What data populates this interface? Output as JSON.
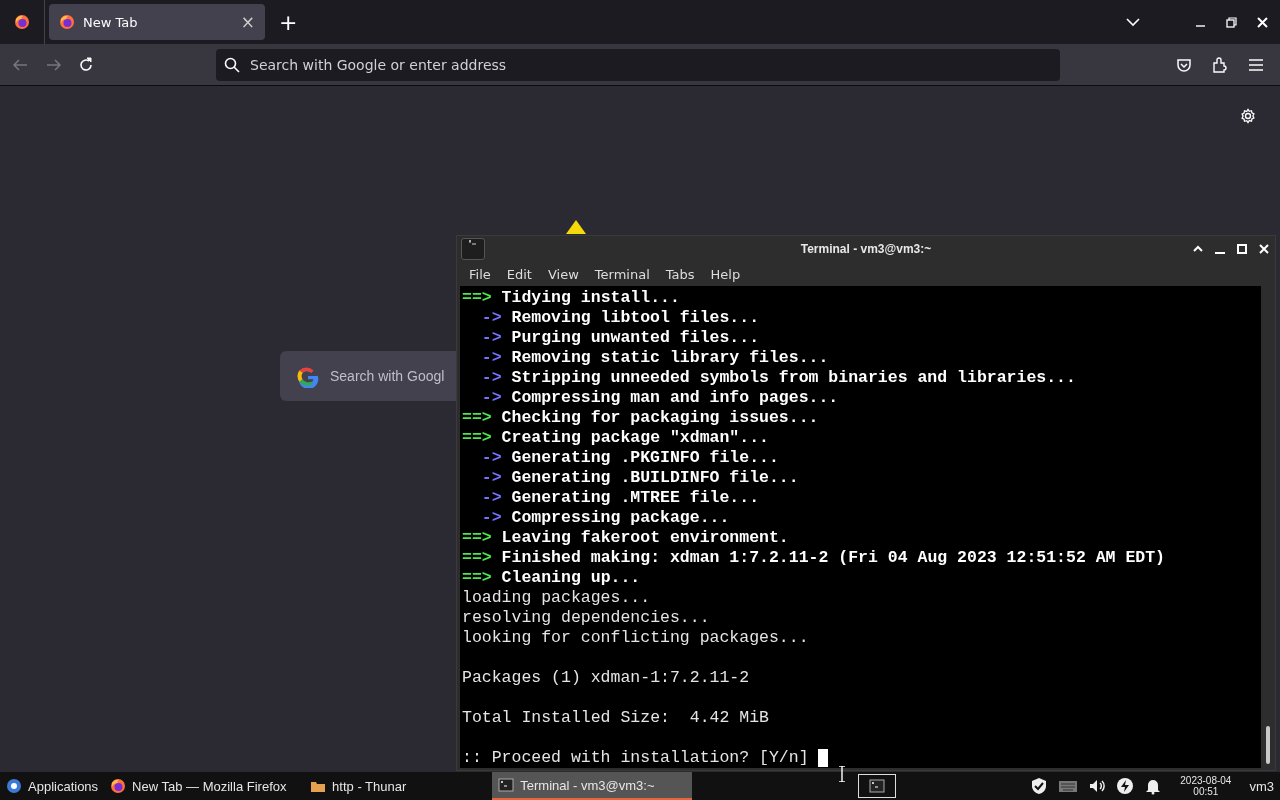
{
  "browser": {
    "tabs": [
      {
        "label": "New Tab",
        "selected": true,
        "close": "×"
      }
    ],
    "new_tab": "+",
    "address": {
      "placeholder": "Search with Google or enter address"
    },
    "content": {
      "search": {
        "placeholder": "Search with Googl"
      }
    }
  },
  "terminal": {
    "title": "Terminal - vm3@vm3:~",
    "menu": [
      "File",
      "Edit",
      "View",
      "Terminal",
      "Tabs",
      "Help"
    ],
    "lines": [
      {
        "kind": "main",
        "arrow": "==>",
        "text": "Tidying install..."
      },
      {
        "kind": "sub",
        "arrow": "->",
        "text": "Removing libtool files..."
      },
      {
        "kind": "sub",
        "arrow": "->",
        "text": "Purging unwanted files..."
      },
      {
        "kind": "sub",
        "arrow": "->",
        "text": "Removing static library files..."
      },
      {
        "kind": "sub",
        "arrow": "->",
        "text": "Stripping unneeded symbols from binaries and libraries..."
      },
      {
        "kind": "sub",
        "arrow": "->",
        "text": "Compressing man and info pages..."
      },
      {
        "kind": "main",
        "arrow": "==>",
        "text": "Checking for packaging issues..."
      },
      {
        "kind": "main",
        "arrow": "==>",
        "text": "Creating package \"xdman\"..."
      },
      {
        "kind": "sub",
        "arrow": "->",
        "text": "Generating .PKGINFO file..."
      },
      {
        "kind": "sub",
        "arrow": "->",
        "text": "Generating .BUILDINFO file..."
      },
      {
        "kind": "sub",
        "arrow": "->",
        "text": "Generating .MTREE file..."
      },
      {
        "kind": "sub",
        "arrow": "->",
        "text": "Compressing package..."
      },
      {
        "kind": "main",
        "arrow": "==>",
        "text": "Leaving fakeroot environment."
      },
      {
        "kind": "main",
        "arrow": "==>",
        "text": "Finished making: xdman 1:7.2.11-2 (Fri 04 Aug 2023 12:51:52 AM EDT)"
      },
      {
        "kind": "main",
        "arrow": "==>",
        "text": "Cleaning up..."
      },
      {
        "kind": "plain",
        "text": "loading packages..."
      },
      {
        "kind": "plain",
        "text": "resolving dependencies..."
      },
      {
        "kind": "plain",
        "text": "looking for conflicting packages..."
      },
      {
        "kind": "blank"
      },
      {
        "kind": "plain",
        "text": "Packages (1) xdman-1:7.2.11-2"
      },
      {
        "kind": "blank"
      },
      {
        "kind": "plain",
        "text": "Total Installed Size:  4.42 MiB"
      },
      {
        "kind": "blank"
      },
      {
        "kind": "prompt",
        "text": ":: Proceed with installation? [Y/n] "
      }
    ]
  },
  "taskbar": {
    "items": [
      {
        "label": "Applications",
        "kind": "menu",
        "selected": false
      },
      {
        "label": "New Tab — Mozilla Firefox",
        "kind": "firefox",
        "selected": false
      },
      {
        "label": "http - Thunar",
        "kind": "folder",
        "selected": false
      },
      {
        "label": "Terminal - vm3@vm3:~",
        "kind": "terminal",
        "selected": true
      }
    ],
    "date": "2023-08-04",
    "time": "00:51",
    "user": "vm3"
  }
}
